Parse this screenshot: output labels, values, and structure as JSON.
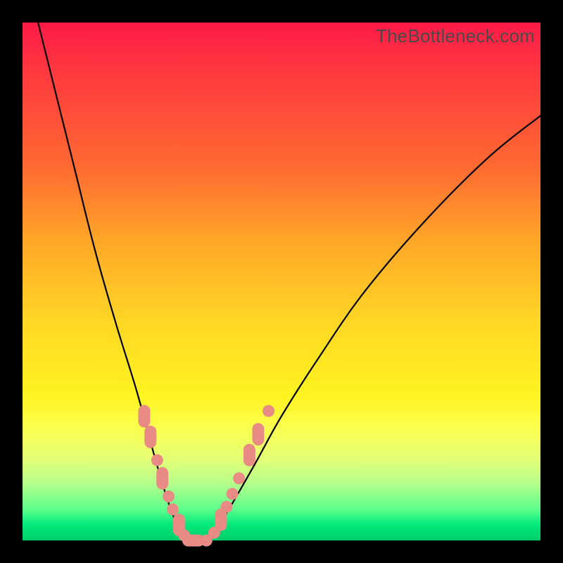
{
  "watermark": "TheBottleneck.com",
  "colors": {
    "dot": "#e88b85",
    "curve": "#000000",
    "gradient_top": "#ff1a47",
    "gradient_bottom": "#00cc6a"
  },
  "chart_data": {
    "type": "line",
    "title": "",
    "xlabel": "",
    "ylabel": "",
    "xlim": [
      0,
      100
    ],
    "ylim": [
      0,
      100
    ],
    "series": [
      {
        "name": "left-curve",
        "x": [
          3,
          6,
          10,
          14,
          18,
          22,
          25,
          27,
          29,
          30.5,
          32
        ],
        "y": [
          100,
          88,
          72,
          56,
          42,
          29,
          18,
          11,
          5,
          2,
          0
        ]
      },
      {
        "name": "right-curve",
        "x": [
          36,
          38,
          41,
          45,
          50,
          57,
          66,
          78,
          90,
          100
        ],
        "y": [
          0,
          3,
          8,
          15,
          24,
          35,
          48,
          62,
          74,
          82
        ]
      },
      {
        "name": "floor",
        "x": [
          32,
          36
        ],
        "y": [
          0,
          0
        ]
      }
    ],
    "markers": {
      "name": "highlighted-points",
      "points": [
        {
          "x": 23.5,
          "y": 24,
          "shape": "pill-v"
        },
        {
          "x": 24.7,
          "y": 20,
          "shape": "pill-v"
        },
        {
          "x": 26.0,
          "y": 15.5,
          "shape": "dot"
        },
        {
          "x": 27.0,
          "y": 12,
          "shape": "pill-v"
        },
        {
          "x": 28.2,
          "y": 8.5,
          "shape": "dot"
        },
        {
          "x": 29.0,
          "y": 6,
          "shape": "dot"
        },
        {
          "x": 30.2,
          "y": 3,
          "shape": "pill-v"
        },
        {
          "x": 31.2,
          "y": 1,
          "shape": "dot"
        },
        {
          "x": 33.0,
          "y": 0,
          "shape": "pill-h"
        },
        {
          "x": 35.5,
          "y": 0,
          "shape": "dot"
        },
        {
          "x": 37.0,
          "y": 1.5,
          "shape": "dot"
        },
        {
          "x": 38.3,
          "y": 4,
          "shape": "pill-v"
        },
        {
          "x": 39.4,
          "y": 6.5,
          "shape": "dot"
        },
        {
          "x": 40.5,
          "y": 9,
          "shape": "dot"
        },
        {
          "x": 41.8,
          "y": 12,
          "shape": "dot"
        },
        {
          "x": 43.8,
          "y": 16.5,
          "shape": "pill-v"
        },
        {
          "x": 45.5,
          "y": 20.5,
          "shape": "pill-v"
        },
        {
          "x": 47.5,
          "y": 25,
          "shape": "dot"
        }
      ]
    }
  }
}
